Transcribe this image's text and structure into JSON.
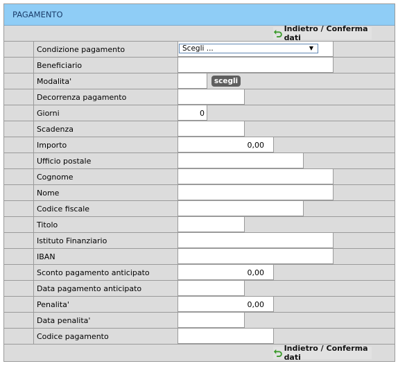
{
  "panel": {
    "title": "PAGAMENTO",
    "back_label": "Indietro / Conferma dati"
  },
  "form": {
    "condizione_label": "Condizione pagamento",
    "condizione_value": "Scegli ...",
    "beneficiario_label": "Beneficiario",
    "modalita_label": "Modalita'",
    "scegli_label": "scegli",
    "decorrenza_label": "Decorrenza pagamento",
    "giorni_label": "Giorni",
    "giorni_value": "0",
    "scadenza_label": "Scadenza",
    "importo_label": "Importo",
    "importo_value": "0,00",
    "ufficio_label": "Ufficio postale",
    "cognome_label": "Cognome",
    "nome_label": "Nome",
    "codice_fiscale_label": "Codice fiscale",
    "titolo_label": "Titolo",
    "istituto_label": "Istituto Finanziario",
    "iban_label": "IBAN",
    "sconto_label": "Sconto pagamento anticipato",
    "sconto_value": "0,00",
    "data_anticipato_label": "Data pagamento anticipato",
    "penalita_label": "Penalita'",
    "penalita_value": "0,00",
    "data_penalita_label": "Data penalita'",
    "codice_pagamento_label": "Codice pagamento"
  },
  "icons": {
    "back": "undo-arrow-icon",
    "dropdown": "caret-down-icon"
  },
  "colors": {
    "header_bg": "#8fcdf6",
    "header_text": "#1b3d6a",
    "panel_bg": "#dcdcdc",
    "back_icon": "#3c9a2c",
    "button_bg": "#5e5e5e"
  }
}
